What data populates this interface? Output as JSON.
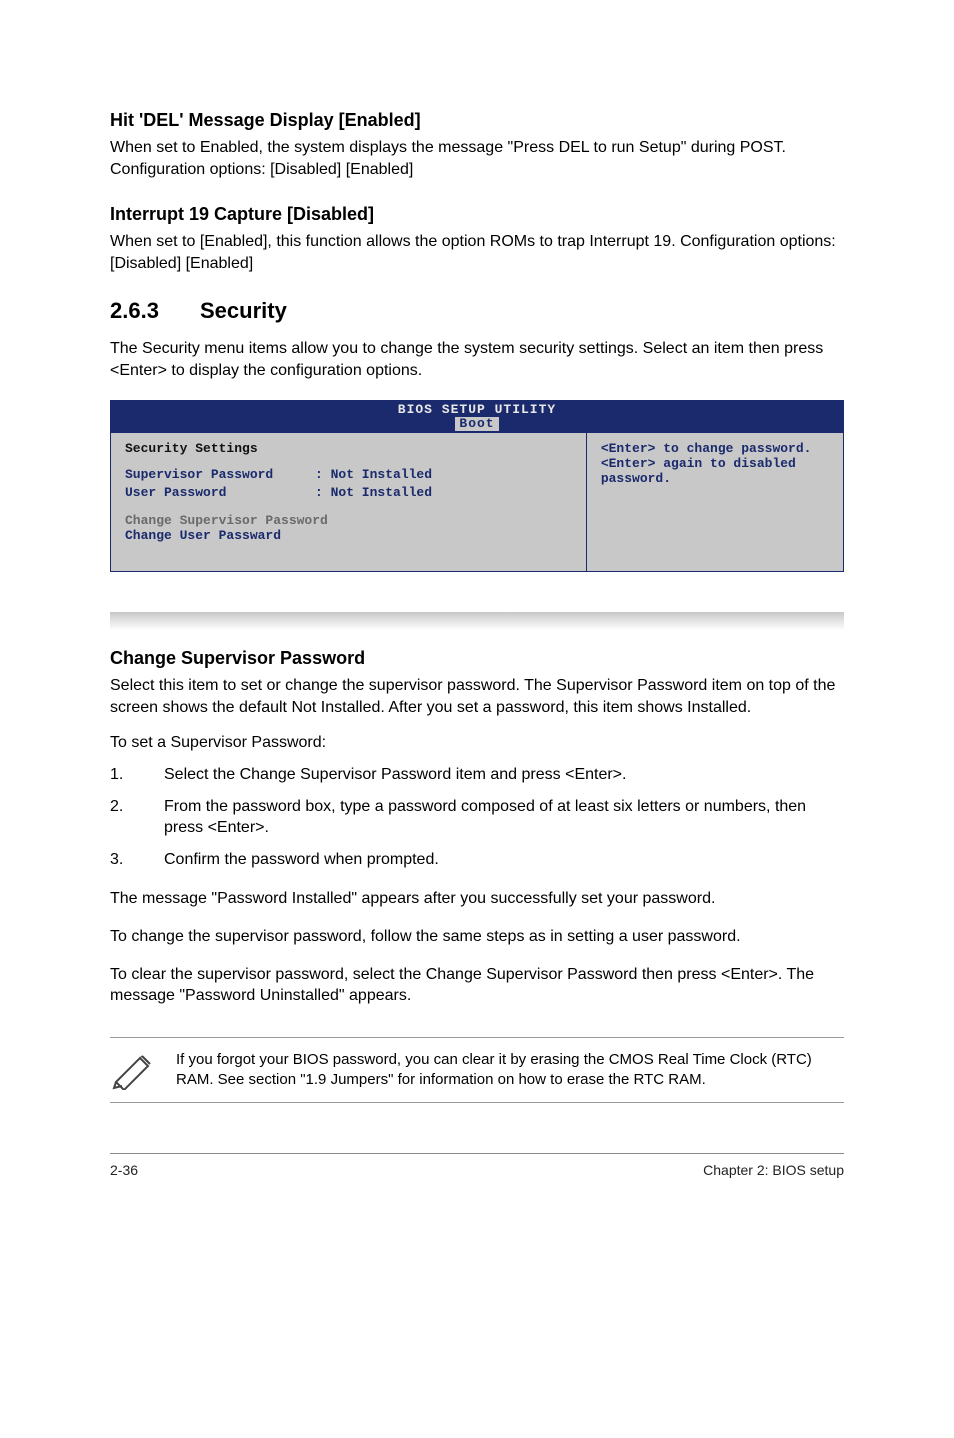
{
  "headings": {
    "hit_del": "Hit 'DEL' Message Display [Enabled]",
    "interrupt_19": "Interrupt 19 Capture [Disabled]",
    "section_263_num": "2.6.3",
    "section_263_title": "Security",
    "change_super": "Change Supervisor Password"
  },
  "paragraphs": {
    "hit_del_body": "When set to Enabled, the system displays the message \"Press DEL to run Setup\" during POST. Configuration options: [Disabled] [Enabled]",
    "interrupt_19_body": "When set to [Enabled], this function allows the option ROMs to trap Interrupt 19. Configuration options: [Disabled] [Enabled]",
    "security_intro": "The Security menu items allow you to change the system security settings. Select an item then press <Enter> to display the configuration options.",
    "change_super_body": "Select this item to set or change the supervisor password. The Supervisor Password item on top of the screen shows the default Not Installed. After you set a password, this item shows Installed.",
    "to_set": "To set a Supervisor Password:",
    "after_set": "The message \"Password Installed\" appears after you successfully set your password.",
    "to_change": "To change the supervisor password, follow the same steps as in setting a user password.",
    "to_clear": "To clear the supervisor password, select the Change Supervisor Password then press <Enter>. The message \"Password Uninstalled\" appears.",
    "note": "If you forgot your BIOS password, you can clear it by erasing the CMOS Real Time Clock (RTC) RAM. See section \"1.9  Jumpers\" for information on how to erase the RTC RAM."
  },
  "steps": [
    {
      "n": "1.",
      "t": "Select the Change Supervisor Password item and press <Enter>."
    },
    {
      "n": "2.",
      "t": "From the password box, type a password composed of at least six letters or numbers, then press <Enter>."
    },
    {
      "n": "3.",
      "t": "Confirm the password when prompted."
    }
  ],
  "bios": {
    "title_top": "BIOS SETUP UTILITY",
    "tab": "Boot",
    "section_heading": "Security Settings",
    "rows": [
      {
        "label": "Supervisor Password",
        "value": ": Not Installed"
      },
      {
        "label": "User Password",
        "value": ": Not Installed"
      }
    ],
    "menu_dim": "Change Supervisor Password",
    "menu_active": "Change User Passward",
    "help": "<Enter> to change password.\n<Enter> again to disabled password."
  },
  "footer": {
    "left": "2-36",
    "right": "Chapter 2: BIOS setup"
  }
}
